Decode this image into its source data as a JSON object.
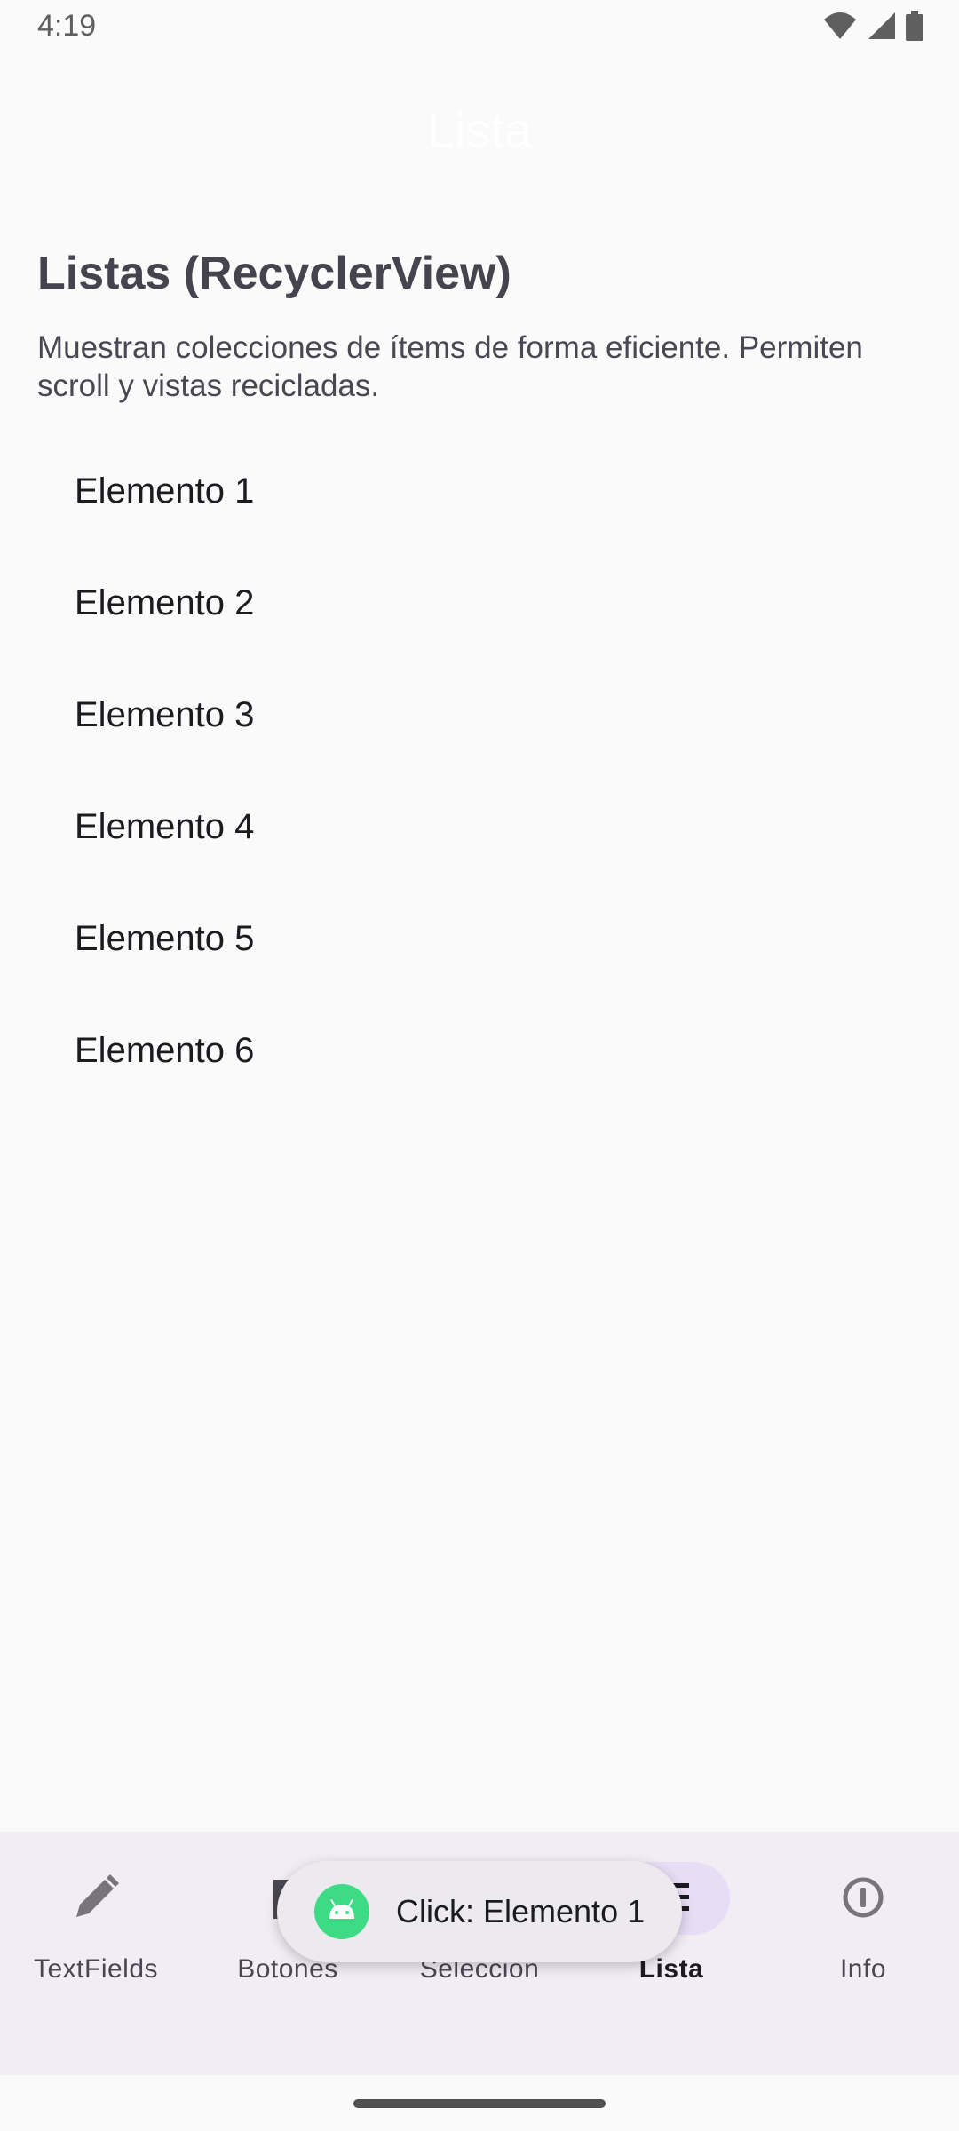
{
  "status_bar": {
    "time": "4:19",
    "icons": [
      "wifi-icon",
      "signal-icon",
      "battery-icon"
    ]
  },
  "top_bar": {
    "title": "Lista"
  },
  "main": {
    "heading": "Listas (RecyclerView)",
    "description": "Muestran colecciones de ítems de forma eficiente. Permiten scroll y vistas recicladas.",
    "items": [
      {
        "label": "Elemento 1"
      },
      {
        "label": "Elemento 2"
      },
      {
        "label": "Elemento 3"
      },
      {
        "label": "Elemento 4"
      },
      {
        "label": "Elemento 5"
      },
      {
        "label": "Elemento 6"
      }
    ]
  },
  "bottom_nav": {
    "items": [
      {
        "label": "TextFields",
        "icon": "pencil-icon",
        "selected": false
      },
      {
        "label": "Botones",
        "icon": "flag-icon",
        "selected": false
      },
      {
        "label": "Selección",
        "icon": "checkbox-icon",
        "selected": false
      },
      {
        "label": "Lista",
        "icon": "list-icon",
        "selected": true
      },
      {
        "label": "Info",
        "icon": "info-icon",
        "selected": false
      }
    ]
  },
  "toast": {
    "text": "Click: Elemento 1",
    "icon": "android-icon"
  },
  "colors": {
    "background": "#FAFAFA",
    "nav_background": "#F2ECF5",
    "nav_indicator": "#E8DDF5",
    "toast_background": "#ECEAEE",
    "android_green": "#3DDC84"
  }
}
